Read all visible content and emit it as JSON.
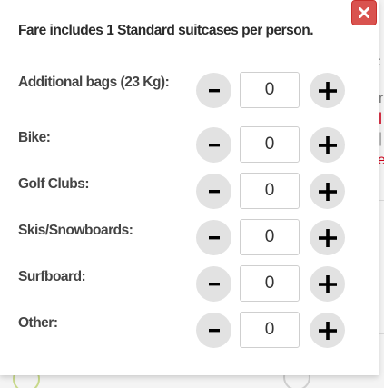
{
  "colors": {
    "close_bg": "#d9534f",
    "stepper_bg": "#e2e2e2",
    "label_text": "#444444",
    "background_accent": "#d0021b"
  },
  "dialog": {
    "close_icon": "close-icon",
    "intro": "Fare includes 1 Standard suitcases per person."
  },
  "rows": [
    {
      "label": "Additional bags (23 Kg):",
      "value": "0",
      "minus": "-",
      "plus": "+"
    },
    {
      "label": "Bike:",
      "value": "0",
      "minus": "-",
      "plus": "+"
    },
    {
      "label": "Golf Clubs:",
      "value": "0",
      "minus": "-",
      "plus": "+"
    },
    {
      "label": "Skis/Snowboards:",
      "value": "0",
      "minus": "-",
      "plus": "+"
    },
    {
      "label": "Surfboard:",
      "value": "0",
      "minus": "-",
      "plus": "+"
    },
    {
      "label": "Other:",
      "value": "0",
      "minus": "-",
      "plus": "+"
    }
  ]
}
